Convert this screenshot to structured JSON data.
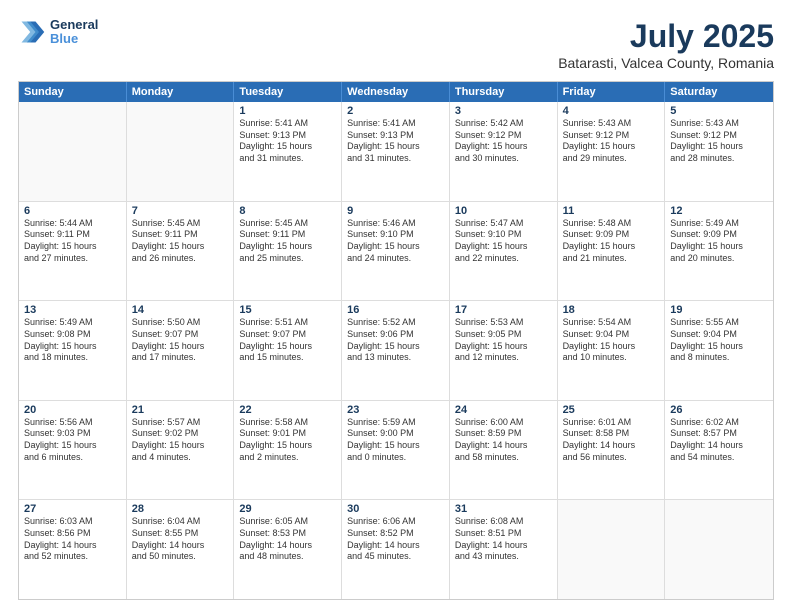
{
  "header": {
    "logo_line1": "General",
    "logo_line2": "Blue",
    "title": "July 2025",
    "subtitle": "Batarasti, Valcea County, Romania"
  },
  "weekdays": [
    "Sunday",
    "Monday",
    "Tuesday",
    "Wednesday",
    "Thursday",
    "Friday",
    "Saturday"
  ],
  "rows": [
    [
      {
        "day": "",
        "lines": []
      },
      {
        "day": "",
        "lines": []
      },
      {
        "day": "1",
        "lines": [
          "Sunrise: 5:41 AM",
          "Sunset: 9:13 PM",
          "Daylight: 15 hours",
          "and 31 minutes."
        ]
      },
      {
        "day": "2",
        "lines": [
          "Sunrise: 5:41 AM",
          "Sunset: 9:13 PM",
          "Daylight: 15 hours",
          "and 31 minutes."
        ]
      },
      {
        "day": "3",
        "lines": [
          "Sunrise: 5:42 AM",
          "Sunset: 9:12 PM",
          "Daylight: 15 hours",
          "and 30 minutes."
        ]
      },
      {
        "day": "4",
        "lines": [
          "Sunrise: 5:43 AM",
          "Sunset: 9:12 PM",
          "Daylight: 15 hours",
          "and 29 minutes."
        ]
      },
      {
        "day": "5",
        "lines": [
          "Sunrise: 5:43 AM",
          "Sunset: 9:12 PM",
          "Daylight: 15 hours",
          "and 28 minutes."
        ]
      }
    ],
    [
      {
        "day": "6",
        "lines": [
          "Sunrise: 5:44 AM",
          "Sunset: 9:11 PM",
          "Daylight: 15 hours",
          "and 27 minutes."
        ]
      },
      {
        "day": "7",
        "lines": [
          "Sunrise: 5:45 AM",
          "Sunset: 9:11 PM",
          "Daylight: 15 hours",
          "and 26 minutes."
        ]
      },
      {
        "day": "8",
        "lines": [
          "Sunrise: 5:45 AM",
          "Sunset: 9:11 PM",
          "Daylight: 15 hours",
          "and 25 minutes."
        ]
      },
      {
        "day": "9",
        "lines": [
          "Sunrise: 5:46 AM",
          "Sunset: 9:10 PM",
          "Daylight: 15 hours",
          "and 24 minutes."
        ]
      },
      {
        "day": "10",
        "lines": [
          "Sunrise: 5:47 AM",
          "Sunset: 9:10 PM",
          "Daylight: 15 hours",
          "and 22 minutes."
        ]
      },
      {
        "day": "11",
        "lines": [
          "Sunrise: 5:48 AM",
          "Sunset: 9:09 PM",
          "Daylight: 15 hours",
          "and 21 minutes."
        ]
      },
      {
        "day": "12",
        "lines": [
          "Sunrise: 5:49 AM",
          "Sunset: 9:09 PM",
          "Daylight: 15 hours",
          "and 20 minutes."
        ]
      }
    ],
    [
      {
        "day": "13",
        "lines": [
          "Sunrise: 5:49 AM",
          "Sunset: 9:08 PM",
          "Daylight: 15 hours",
          "and 18 minutes."
        ]
      },
      {
        "day": "14",
        "lines": [
          "Sunrise: 5:50 AM",
          "Sunset: 9:07 PM",
          "Daylight: 15 hours",
          "and 17 minutes."
        ]
      },
      {
        "day": "15",
        "lines": [
          "Sunrise: 5:51 AM",
          "Sunset: 9:07 PM",
          "Daylight: 15 hours",
          "and 15 minutes."
        ]
      },
      {
        "day": "16",
        "lines": [
          "Sunrise: 5:52 AM",
          "Sunset: 9:06 PM",
          "Daylight: 15 hours",
          "and 13 minutes."
        ]
      },
      {
        "day": "17",
        "lines": [
          "Sunrise: 5:53 AM",
          "Sunset: 9:05 PM",
          "Daylight: 15 hours",
          "and 12 minutes."
        ]
      },
      {
        "day": "18",
        "lines": [
          "Sunrise: 5:54 AM",
          "Sunset: 9:04 PM",
          "Daylight: 15 hours",
          "and 10 minutes."
        ]
      },
      {
        "day": "19",
        "lines": [
          "Sunrise: 5:55 AM",
          "Sunset: 9:04 PM",
          "Daylight: 15 hours",
          "and 8 minutes."
        ]
      }
    ],
    [
      {
        "day": "20",
        "lines": [
          "Sunrise: 5:56 AM",
          "Sunset: 9:03 PM",
          "Daylight: 15 hours",
          "and 6 minutes."
        ]
      },
      {
        "day": "21",
        "lines": [
          "Sunrise: 5:57 AM",
          "Sunset: 9:02 PM",
          "Daylight: 15 hours",
          "and 4 minutes."
        ]
      },
      {
        "day": "22",
        "lines": [
          "Sunrise: 5:58 AM",
          "Sunset: 9:01 PM",
          "Daylight: 15 hours",
          "and 2 minutes."
        ]
      },
      {
        "day": "23",
        "lines": [
          "Sunrise: 5:59 AM",
          "Sunset: 9:00 PM",
          "Daylight: 15 hours",
          "and 0 minutes."
        ]
      },
      {
        "day": "24",
        "lines": [
          "Sunrise: 6:00 AM",
          "Sunset: 8:59 PM",
          "Daylight: 14 hours",
          "and 58 minutes."
        ]
      },
      {
        "day": "25",
        "lines": [
          "Sunrise: 6:01 AM",
          "Sunset: 8:58 PM",
          "Daylight: 14 hours",
          "and 56 minutes."
        ]
      },
      {
        "day": "26",
        "lines": [
          "Sunrise: 6:02 AM",
          "Sunset: 8:57 PM",
          "Daylight: 14 hours",
          "and 54 minutes."
        ]
      }
    ],
    [
      {
        "day": "27",
        "lines": [
          "Sunrise: 6:03 AM",
          "Sunset: 8:56 PM",
          "Daylight: 14 hours",
          "and 52 minutes."
        ]
      },
      {
        "day": "28",
        "lines": [
          "Sunrise: 6:04 AM",
          "Sunset: 8:55 PM",
          "Daylight: 14 hours",
          "and 50 minutes."
        ]
      },
      {
        "day": "29",
        "lines": [
          "Sunrise: 6:05 AM",
          "Sunset: 8:53 PM",
          "Daylight: 14 hours",
          "and 48 minutes."
        ]
      },
      {
        "day": "30",
        "lines": [
          "Sunrise: 6:06 AM",
          "Sunset: 8:52 PM",
          "Daylight: 14 hours",
          "and 45 minutes."
        ]
      },
      {
        "day": "31",
        "lines": [
          "Sunrise: 6:08 AM",
          "Sunset: 8:51 PM",
          "Daylight: 14 hours",
          "and 43 minutes."
        ]
      },
      {
        "day": "",
        "lines": []
      },
      {
        "day": "",
        "lines": []
      }
    ]
  ]
}
